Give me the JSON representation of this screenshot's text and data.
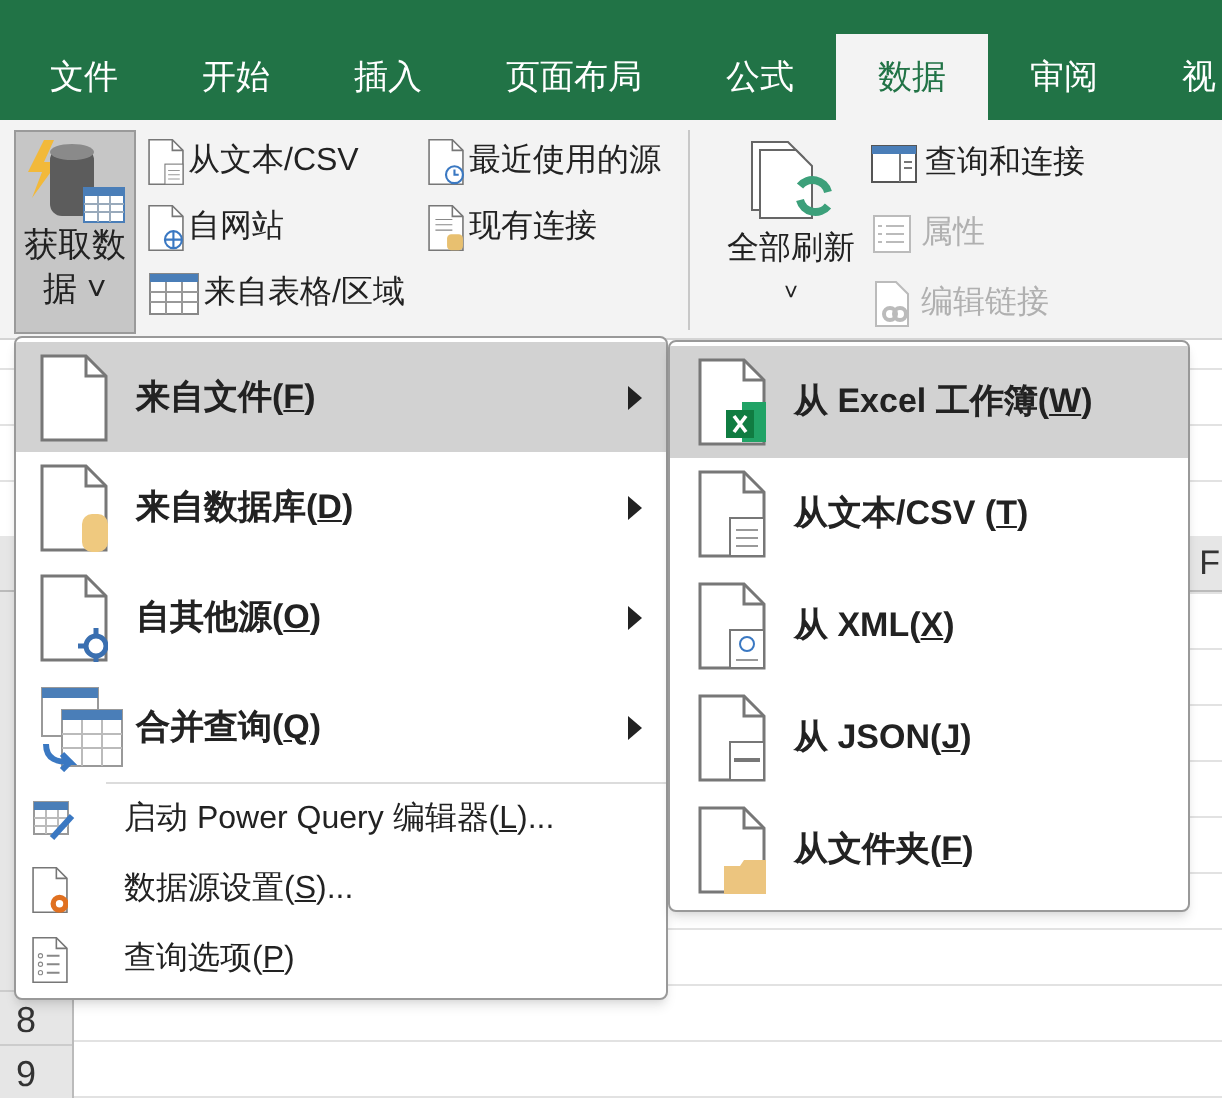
{
  "tabs": [
    {
      "label": "文件",
      "selected": false
    },
    {
      "label": "开始",
      "selected": false
    },
    {
      "label": "插入",
      "selected": false
    },
    {
      "label": "页面布局",
      "selected": false
    },
    {
      "label": "公式",
      "selected": false
    },
    {
      "label": "数据",
      "selected": true
    },
    {
      "label": "审阅",
      "selected": false
    },
    {
      "label": "视",
      "selected": false
    }
  ],
  "ribbon": {
    "get_data": {
      "label": "获取数据",
      "dropdown_mark": "˅",
      "pressed": true
    },
    "source_columns": [
      [
        {
          "label": "从文本/CSV"
        },
        {
          "label": "自网站"
        },
        {
          "label": "来自表格/区域"
        }
      ],
      [
        {
          "label": "最近使用的源"
        },
        {
          "label": "现有连接"
        }
      ]
    ],
    "refresh_all": {
      "label": "全部刷新",
      "dropdown_mark": "˅"
    },
    "query_commands": [
      {
        "label": "查询和连接",
        "disabled": false
      },
      {
        "label": "属性",
        "disabled": true
      },
      {
        "label": "编辑链接",
        "disabled": true
      }
    ]
  },
  "sheet": {
    "column_header": "F",
    "row_headers": [
      "8",
      "9"
    ]
  },
  "menu": {
    "items": [
      {
        "kind": "large",
        "text": "来自文件(",
        "key": "F",
        "after": ")",
        "highlighted": true,
        "has_submenu": true
      },
      {
        "kind": "large",
        "text": "来自数据库(",
        "key": "D",
        "after": ")",
        "highlighted": false,
        "has_submenu": true
      },
      {
        "kind": "large",
        "text": "自其他源(",
        "key": "O",
        "after": ")",
        "highlighted": false,
        "has_submenu": true
      },
      {
        "kind": "large",
        "text": "合并查询(",
        "key": "Q",
        "after": ")",
        "highlighted": false,
        "has_submenu": true
      },
      {
        "kind": "small",
        "text": "启动 Power Query 编辑器(",
        "key": "L",
        "after": ")...",
        "highlighted": false,
        "has_submenu": false
      },
      {
        "kind": "small",
        "text": "数据源设置(",
        "key": "S",
        "after": ")...",
        "highlighted": false,
        "has_submenu": false
      },
      {
        "kind": "small",
        "text": "查询选项(",
        "key": "P",
        "after": ")",
        "highlighted": false,
        "has_submenu": false
      }
    ]
  },
  "submenu": {
    "items": [
      {
        "text": "从 Excel 工作簿(",
        "key": "W",
        "after": ")",
        "highlighted": true
      },
      {
        "text": "从文本/CSV (",
        "key": "T",
        "after": ")",
        "highlighted": false
      },
      {
        "text": "从 XML(",
        "key": "X",
        "after": ")",
        "highlighted": false
      },
      {
        "text": "从 JSON(",
        "key": "J",
        "after": ")",
        "highlighted": false
      },
      {
        "text": "从文件夹(",
        "key": "F",
        "after": ")",
        "highlighted": false
      }
    ]
  }
}
